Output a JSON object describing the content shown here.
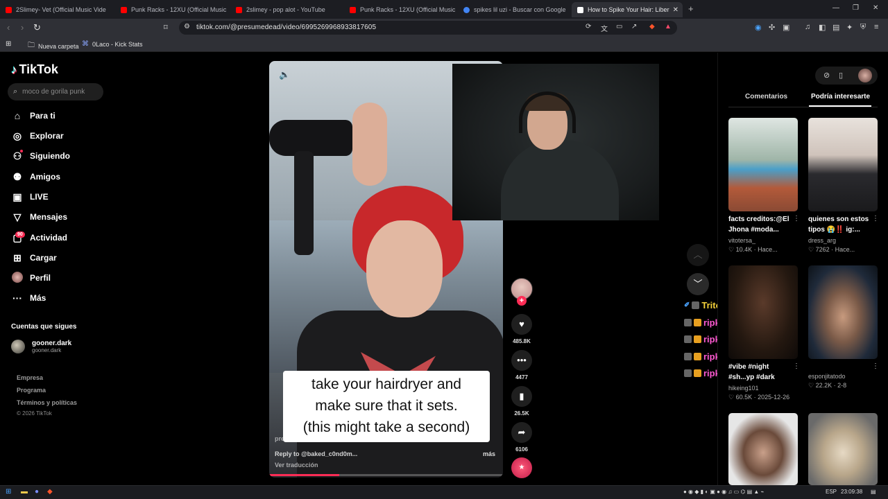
{
  "browser": {
    "tabs": [
      {
        "title": "2Slimey- Vet (Official Music Vide",
        "color": "#ff0000"
      },
      {
        "title": "Punk Racks - 12XU (Official Music Vi",
        "color": "#ff0000"
      },
      {
        "title": "2slimey - pop alot - YouTube",
        "color": "#ff0000"
      },
      {
        "title": "Punk Racks - 12XU (Official Music Vi",
        "color": "#ff0000"
      },
      {
        "title": "spikes lil uzi - Buscar con Google",
        "color": "#4285f4"
      },
      {
        "title": "How to Spike Your Hair: Liber",
        "color": "#ffffff"
      }
    ],
    "url": "tiktok.com/@presumedead/video/6995269968933817605",
    "bookmarks": [
      {
        "label": "Nueva carpeta",
        "icon": "folder-icon"
      },
      {
        "label": "0Laco - Kick Stats",
        "icon": "kick-icon"
      }
    ]
  },
  "sidebar": {
    "logo": "TikTok",
    "search_placeholder": "moco de gorila punk",
    "nav": [
      {
        "label": "Para ti",
        "icon": "home-icon"
      },
      {
        "label": "Explorar",
        "icon": "compass-icon"
      },
      {
        "label": "Siguiendo",
        "icon": "following-icon"
      },
      {
        "label": "Amigos",
        "icon": "friends-icon"
      },
      {
        "label": "LIVE",
        "icon": "live-icon"
      },
      {
        "label": "Mensajes",
        "icon": "messages-icon"
      },
      {
        "label": "Actividad",
        "icon": "activity-icon"
      },
      {
        "label": "Cargar",
        "icon": "upload-icon"
      },
      {
        "label": "Perfil",
        "icon": "profile-icon"
      },
      {
        "label": "Más",
        "icon": "more-icon"
      }
    ],
    "activity_badge": "90",
    "following_heading": "Cuentas que sigues",
    "following": {
      "name": "gooner.dark",
      "handle": "gooner.dark"
    },
    "footer_links": [
      "Empresa",
      "Programa",
      "Términos y políticas"
    ],
    "copyright": "© 2026 TikTok"
  },
  "video": {
    "caption_lines": [
      "take your hairdryer and",
      "make sure that it sets.",
      "(this might take a second)"
    ],
    "author": "presumedead",
    "reply": "Reply to @baked_c0nd0m...",
    "more": "más",
    "translate": "Ver traducción",
    "progress": 0.3
  },
  "actions": {
    "likes": "485.8K",
    "comments": "4477",
    "saves": "26.5K",
    "shares": "6106"
  },
  "chat": [
    {
      "user": "Tritonsillo:",
      "color": "#f5d23a"
    },
    {
      "user": "ripkeni:",
      "color": "#ff5ad2"
    },
    {
      "user": "ripkeni:",
      "color": "#ff5ad2"
    },
    {
      "user": "ripkeni:",
      "color": "#ff5ad2"
    },
    {
      "user": "ripkeni:",
      "color": "#ff5ad2"
    }
  ],
  "right_panel": {
    "tab_comments": "Comentarios",
    "tab_suggested": "Podría interesarte",
    "cards": [
      {
        "title": "facts creditos:@El",
        "title2": "Jhona #moda...",
        "user": "vitotersa_",
        "likes": "10.4K",
        "age": "Hace..."
      },
      {
        "title": "quienes son estos",
        "title2": "tipos 😭‼️ ig:...",
        "user": "dress_arg",
        "likes": "7262",
        "age": "Hace..."
      },
      {
        "title": "#vibe #night",
        "title2": "#sh...yp #dark",
        "user": "hikeing101",
        "likes": "60.5K",
        "age": "2025-12-26"
      },
      {
        "title": "",
        "title2": "",
        "user": "esponjitatodo",
        "likes": "22.2K",
        "age": "2-8"
      }
    ]
  },
  "taskbar": {
    "lang": "ESP",
    "time": "23:09:38"
  }
}
